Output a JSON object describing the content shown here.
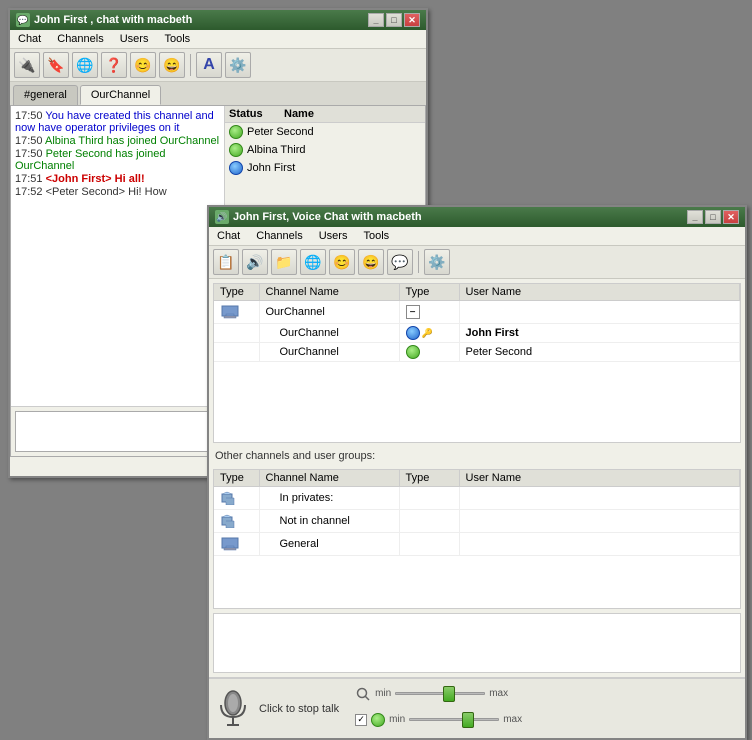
{
  "main_window": {
    "title": "John First , chat with macbeth",
    "menu": [
      "Chat",
      "Channels",
      "Users",
      "Tools"
    ],
    "tabs": [
      {
        "label": "#general",
        "active": false
      },
      {
        "label": "OurChannel",
        "active": true
      }
    ],
    "messages": [
      {
        "time": "17:50",
        "text": "You have created this channel and now have operator privileges on it",
        "type": "system"
      },
      {
        "time": "17:50",
        "text": "Albina Third has joined OurChannel",
        "type": "join"
      },
      {
        "time": "17:50",
        "text": "Peter Second has joined OurChannel",
        "type": "join"
      },
      {
        "time": "17:51",
        "text": "<John First> Hi all!",
        "type": "me"
      },
      {
        "time": "17:52",
        "text": "<Peter Second> Hi! How",
        "type": "other"
      }
    ],
    "user_panel": {
      "headers": [
        "Status",
        "Name"
      ],
      "users": [
        {
          "name": "Peter Second",
          "status": "online"
        },
        {
          "name": "Albina Third",
          "status": "online"
        },
        {
          "name": "John First",
          "status": "online"
        }
      ]
    }
  },
  "voice_window": {
    "title": "John First, Voice Chat with macbeth",
    "menu": [
      "Chat",
      "Channels",
      "Users",
      "Tools"
    ],
    "table_headers": [
      "Type",
      "Channel Name",
      "Type",
      "User Name"
    ],
    "rows": [
      {
        "channel": "OurChannel",
        "type": "expand",
        "indent": 0
      },
      {
        "channel": "OurChannel",
        "type": "user",
        "username": "John First",
        "bold": true,
        "indent": 1
      },
      {
        "channel": "OurChannel",
        "type": "user",
        "username": "Peter Second",
        "bold": false,
        "indent": 1
      }
    ],
    "other_section_label": "Other channels and user groups:",
    "other_table_headers": [
      "Type",
      "Channel Name",
      "Type",
      "User Name"
    ],
    "other_rows": [
      {
        "channel": "In privates:",
        "indent": 1
      },
      {
        "channel": "Not in channel",
        "indent": 1
      },
      {
        "channel": "General",
        "indent": 1
      }
    ],
    "bottom": {
      "click_to_stop": "Click to stop talk",
      "min_label": "min",
      "max_label": "max",
      "min_label2": "min",
      "max_label2": "max"
    }
  }
}
